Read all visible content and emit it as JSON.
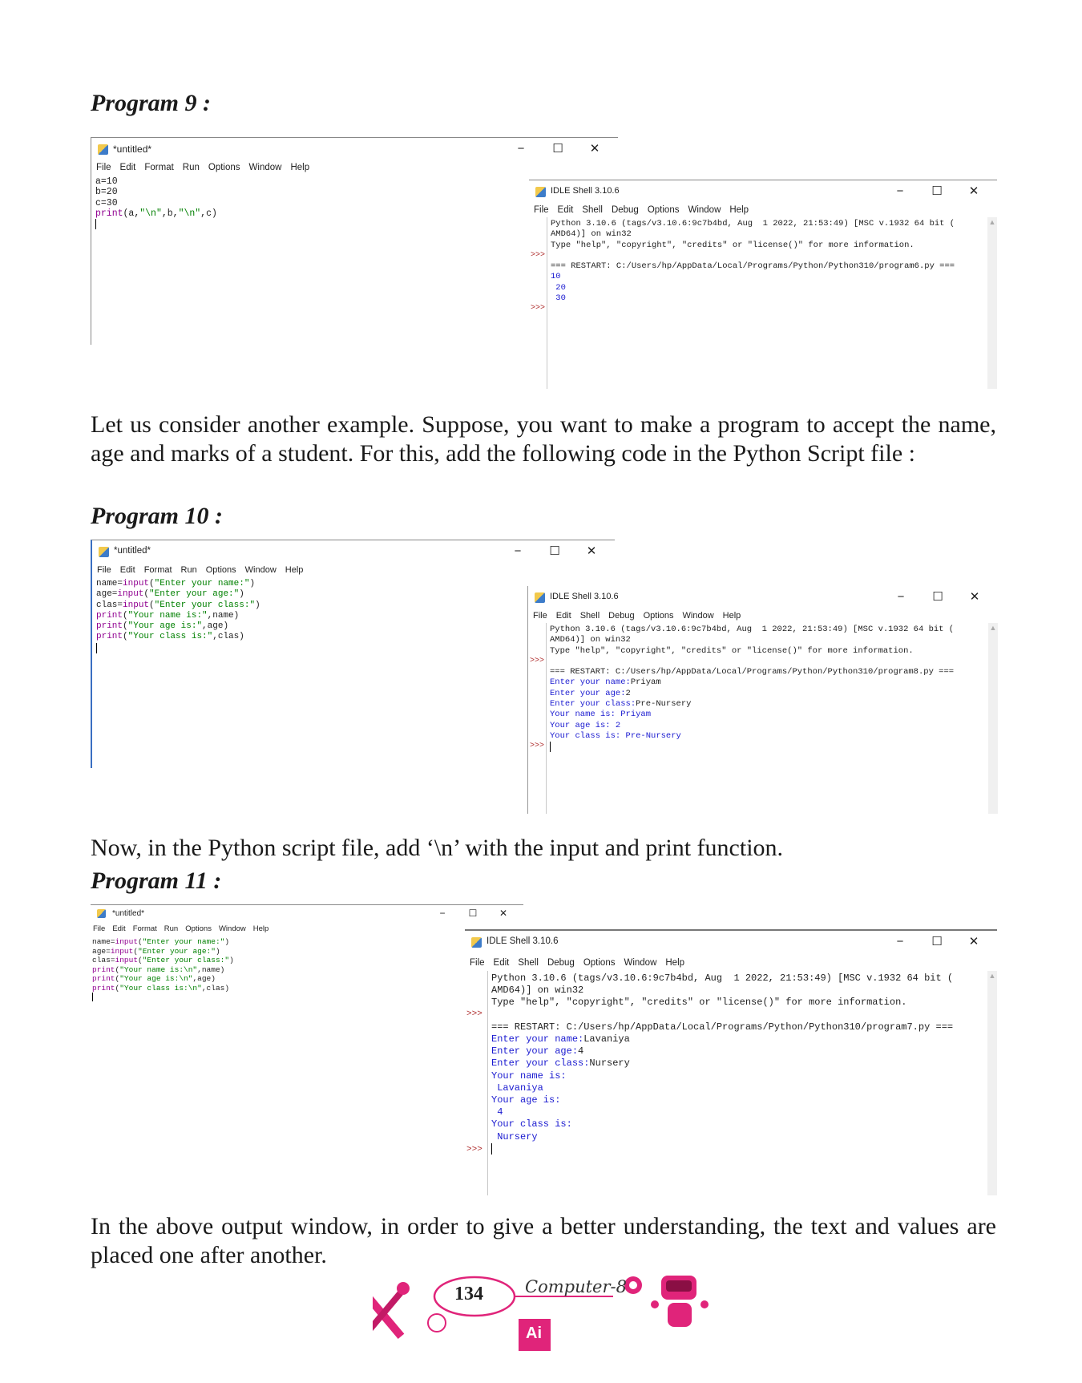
{
  "program9": {
    "heading": "Program 9 :",
    "editor": {
      "title": "*untitled*",
      "menu": [
        "File",
        "Edit",
        "Format",
        "Run",
        "Options",
        "Window",
        "Help"
      ],
      "lines": [
        "a=10",
        "b=20",
        "c=30"
      ],
      "print_kw": "print",
      "print_args_1": "(a,",
      "print_str_1": "\"\\n\"",
      "print_args_2": ",b,",
      "print_str_2": "\"\\n\"",
      "print_args_3": ",c)"
    },
    "shell": {
      "title": "IDLE Shell 3.10.6",
      "menu": [
        "File",
        "Edit",
        "Shell",
        "Debug",
        "Options",
        "Window",
        "Help"
      ],
      "banner_1": "Python 3.10.6 (tags/v3.10.6:9c7b4bd, Aug  1 2022, 21:53:49) [MSC v.1932 64 bit (",
      "banner_2": "AMD64)] on win32",
      "banner_3": "Type \"help\", \"copyright\", \"credits\" or \"license()\" for more information.",
      "restart": "=== RESTART: C:/Users/hp/AppData/Local/Programs/Python/Python310/program6.py ===",
      "output": [
        "10",
        " 20",
        " 30"
      ],
      "prompt": ">>>"
    }
  },
  "para1": "Let us consider another example. Suppose, you want to make a program to accept the name, age and marks of a student. For this, add the following code in the Python Script file :",
  "program10": {
    "heading": "Program 10 :",
    "editor": {
      "title": "*untitled*",
      "menu": [
        "File",
        "Edit",
        "Format",
        "Run",
        "Options",
        "Window",
        "Help"
      ],
      "lines": [
        {
          "var": "name=",
          "fn": "input",
          "open": "(",
          "str": "\"Enter your name:\"",
          "rest": ")"
        },
        {
          "var": "age=",
          "fn": "input",
          "open": "(",
          "str": "\"Enter your age:\"",
          "rest": ")"
        },
        {
          "var": "clas=",
          "fn": "input",
          "open": "(",
          "str": "\"Enter your class:\"",
          "rest": ")"
        },
        {
          "var": "",
          "fn": "print",
          "open": "(",
          "str": "\"Your name is:\"",
          "rest": ",name)"
        },
        {
          "var": "",
          "fn": "print",
          "open": "(",
          "str": "\"Your age is:\"",
          "rest": ",age)"
        },
        {
          "var": "",
          "fn": "print",
          "open": "(",
          "str": "\"Your class is:\"",
          "rest": ",clas)"
        }
      ]
    },
    "shell": {
      "title": "IDLE Shell 3.10.6",
      "menu": [
        "File",
        "Edit",
        "Shell",
        "Debug",
        "Options",
        "Window",
        "Help"
      ],
      "banner_1": "Python 3.10.6 (tags/v3.10.6:9c7b4bd, Aug  1 2022, 21:53:49) [MSC v.1932 64 bit (",
      "banner_2": "AMD64)] on win32",
      "banner_3": "Type \"help\", \"copyright\", \"credits\" or \"license()\" for more information.",
      "restart": "=== RESTART: C:/Users/hp/AppData/Local/Programs/Python/Python310/program8.py ===",
      "prompt": ">>>",
      "io": [
        {
          "prompt": "Enter your name:",
          "input": "Priyam"
        },
        {
          "prompt": "Enter your age:",
          "input": "2"
        },
        {
          "prompt": "Enter your class:",
          "input": "Pre-Nursery"
        }
      ],
      "output": [
        "Your name is: Priyam",
        "Your age is: 2",
        "Your class is: Pre-Nursery"
      ]
    }
  },
  "para2": "Now, in the Python script file, add ‘\\n’ with the input and print function.",
  "program11": {
    "heading": "Program 11 :",
    "editor": {
      "title": "*untitled*",
      "menu": [
        "File",
        "Edit",
        "Format",
        "Run",
        "Options",
        "Window",
        "Help"
      ],
      "lines": [
        {
          "var": "name=",
          "fn": "input",
          "open": "(",
          "str": "\"Enter your name:\"",
          "rest": ")"
        },
        {
          "var": "age=",
          "fn": "input",
          "open": "(",
          "str": "\"Enter your age:\"",
          "rest": ")"
        },
        {
          "var": "clas=",
          "fn": "input",
          "open": "(",
          "str": "\"Enter your class:\"",
          "rest": ")"
        },
        {
          "var": "",
          "fn": "print",
          "open": "(",
          "str": "\"Your name is:\\n\"",
          "rest": ",name)"
        },
        {
          "var": "",
          "fn": "print",
          "open": "(",
          "str": "\"Your age is:\\n\"",
          "rest": ",age)"
        },
        {
          "var": "",
          "fn": "print",
          "open": "(",
          "str": "\"Your class is:\\n\"",
          "rest": ",clas)"
        }
      ]
    },
    "shell": {
      "title": "IDLE Shell 3.10.6",
      "menu": [
        "File",
        "Edit",
        "Shell",
        "Debug",
        "Options",
        "Window",
        "Help"
      ],
      "banner_1": "Python 3.10.6 (tags/v3.10.6:9c7b4bd, Aug  1 2022, 21:53:49) [MSC v.1932 64 bit (",
      "banner_2": "AMD64)] on win32",
      "banner_3": "Type \"help\", \"copyright\", \"credits\" or \"license()\" for more information.",
      "restart": "=== RESTART: C:/Users/hp/AppData/Local/Programs/Python/Python310/program7.py ===",
      "prompt": ">>>",
      "io": [
        {
          "prompt": "Enter your name:",
          "input": "Lavaniya"
        },
        {
          "prompt": "Enter your age:",
          "input": "4"
        },
        {
          "prompt": "Enter your class:",
          "input": "Nursery"
        }
      ],
      "output": [
        "Your name is:",
        " Lavaniya",
        "Your age is:",
        " 4",
        "Your class is:",
        " Nursery"
      ]
    }
  },
  "para3": "In the above output window, in order to give a better understanding, the text and values are placed one after another.",
  "footer": {
    "page_number": "134",
    "book_title": "Computer-8",
    "badge": "Ai",
    "accent_color": "#e0247a"
  },
  "window_controls": {
    "minimize": "−",
    "maximize": "☐",
    "close": "✕"
  }
}
